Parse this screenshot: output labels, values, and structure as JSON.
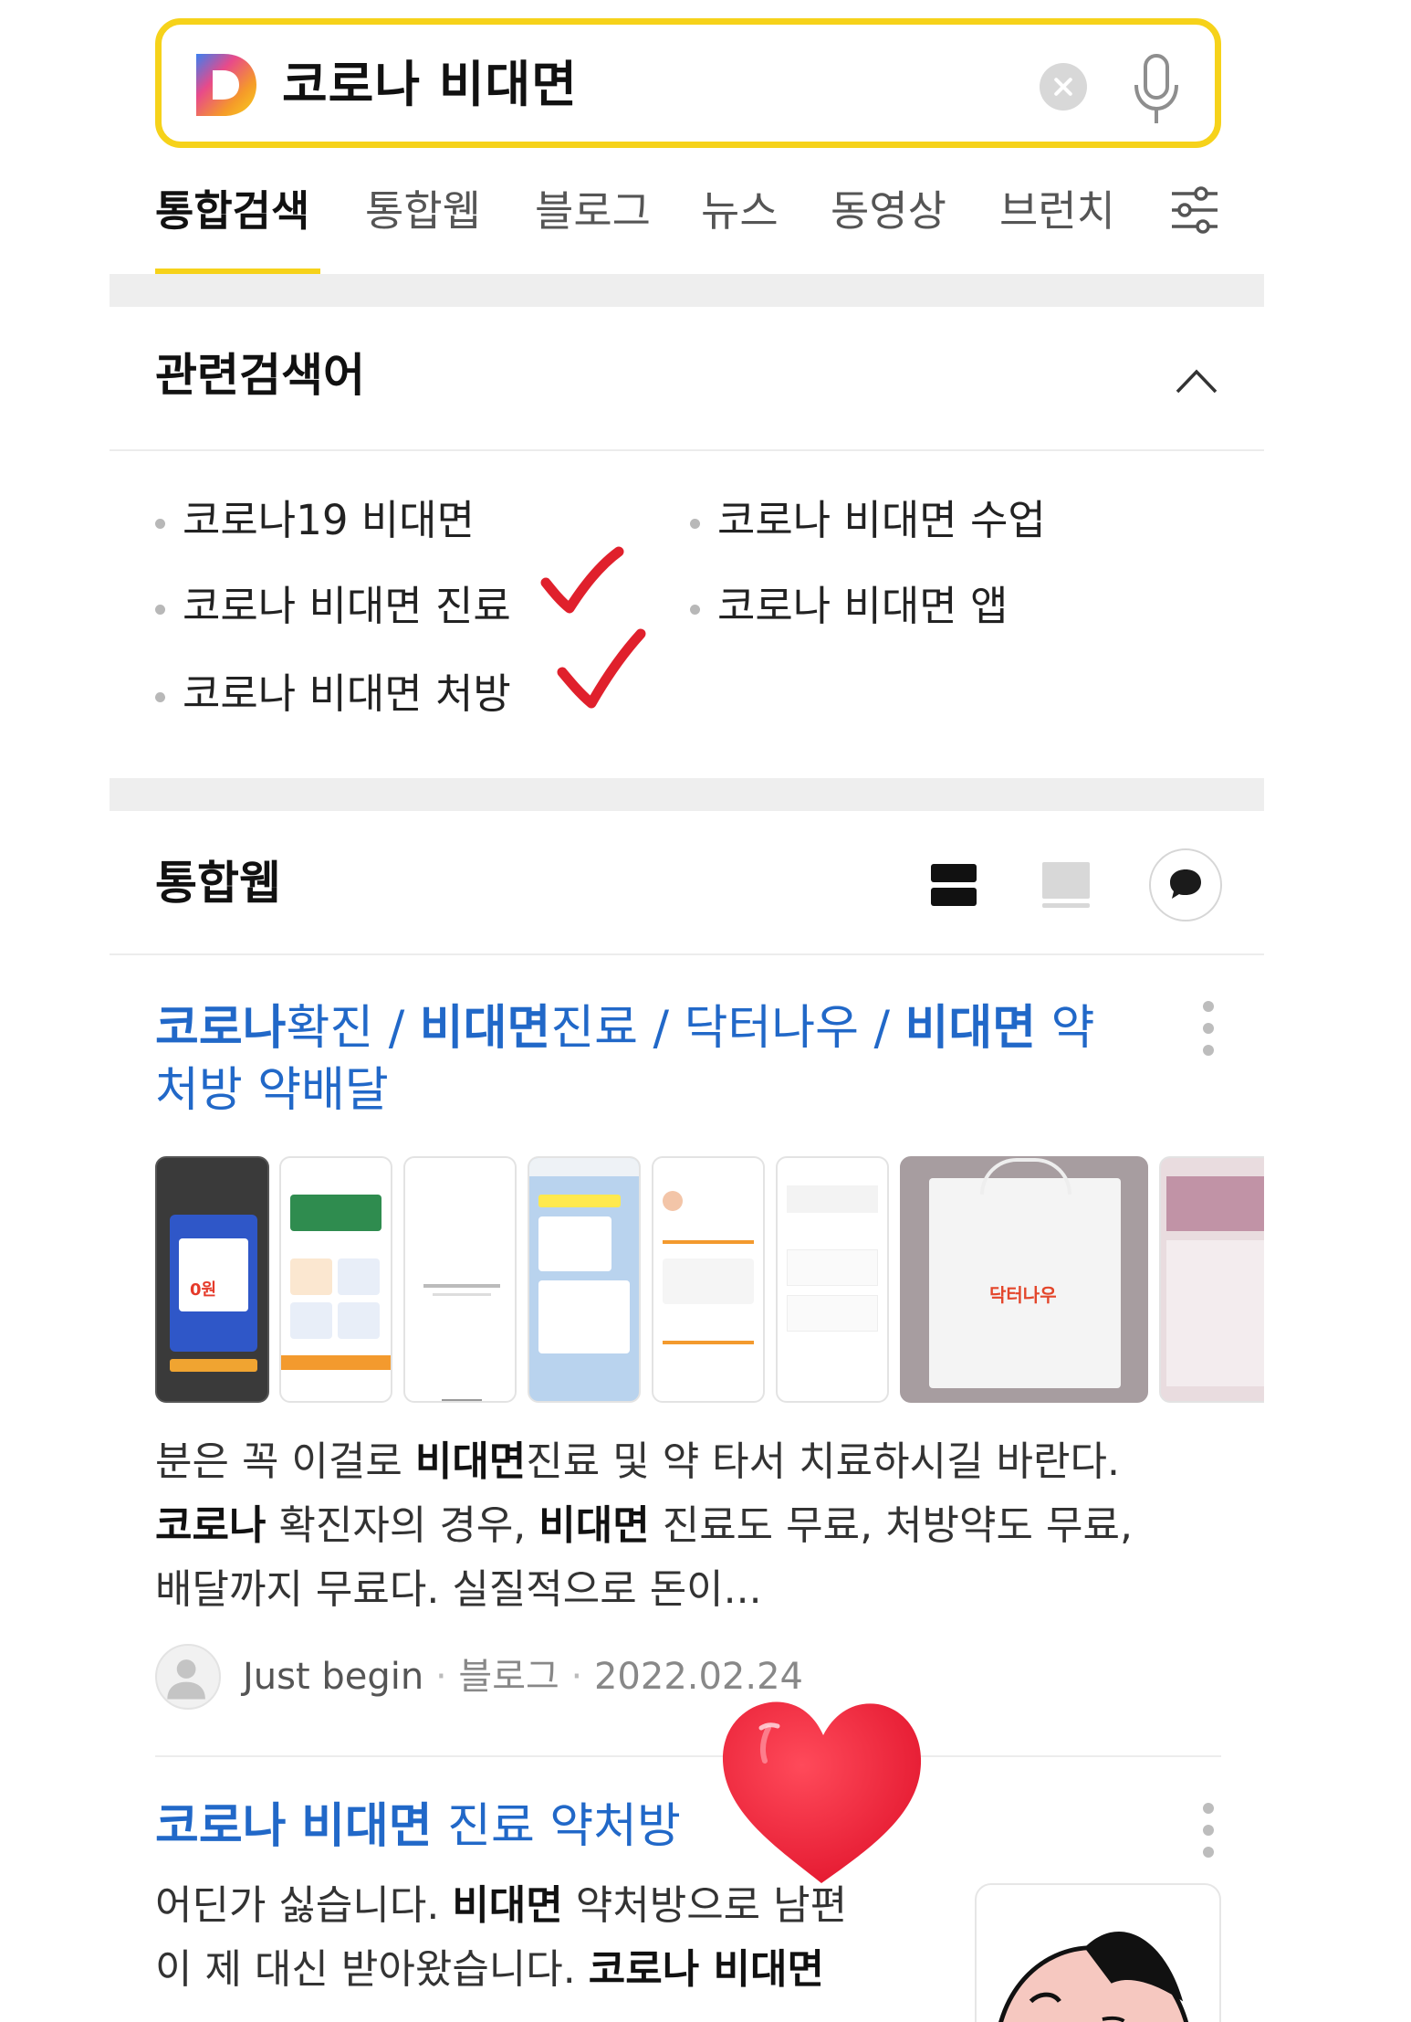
{
  "search": {
    "query": "코로나 비대면",
    "logo_letter": "D"
  },
  "tabs": [
    "통합검색",
    "통합웹",
    "블로그",
    "뉴스",
    "동영상",
    "브런치"
  ],
  "related": {
    "title": "관련검색어",
    "items": [
      "코로나19 비대면",
      "코로나 비대면 수업",
      "코로나 비대면 진료",
      "코로나 비대면 앱",
      "코로나 비대면 처방"
    ]
  },
  "web": {
    "title": "통합웹",
    "result1": {
      "title_parts": [
        {
          "t": "코로나",
          "b": true
        },
        {
          "t": "확진 / ",
          "b": false
        },
        {
          "t": "비대면",
          "b": true
        },
        {
          "t": "진료 / 닥터나우 / ",
          "b": false
        },
        {
          "t": "비대면",
          "b": true
        },
        {
          "t": " 약",
          "b": false
        }
      ],
      "title_line2": "처방 약배달",
      "snippet_line1_a": "분은 꼭 이걸로 ",
      "snippet_line1_b": "비대면",
      "snippet_line1_c": "진료 및 약 타서 치료하시길 바란다.",
      "snippet_line2_a": "코로나",
      "snippet_line2_b": " 확진자의 경우, ",
      "snippet_line2_c": "비대면",
      "snippet_line2_d": " 진료도 무료, 처방약도 무료,",
      "snippet_line3": "배달까지 무료다. 실질적으로 돈이...",
      "author": "Just begin",
      "source": "블로그",
      "date": "2022.02.24",
      "thumb_bag_brand": "닥터나우",
      "thumb_card_price": "0원"
    },
    "result2": {
      "title_b1": "코로나",
      "title_sp": " ",
      "title_b2": "비대면",
      "title_rest": " 진료 약처방",
      "snippet_line1_a": "어딘가 싫습니다. ",
      "snippet_line1_b": "비대면",
      "snippet_line1_c": " 약처방으로 남편",
      "snippet_line2_a": "이 제 대신 받아왔습니다. ",
      "snippet_line2_b": "코로나 비대면"
    }
  },
  "colors": {
    "accent_yellow": "#f6d21a",
    "link_blue": "#2168c8",
    "check_red": "#e0202c"
  }
}
